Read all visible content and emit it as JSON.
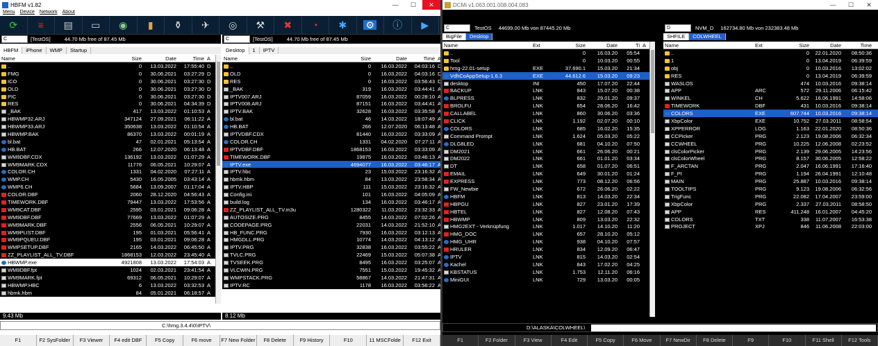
{
  "w1": {
    "title": "HBFM v1.82",
    "menu": [
      "Menu",
      "Device",
      "Network",
      "About"
    ],
    "toolbar_icons": [
      "refresh-icon",
      "stack-icon",
      "printer-icon",
      "hdd-icon",
      "disk-ok-icon",
      "battery-icon",
      "jar-icon",
      "plane-icon",
      "cd-icon",
      "tools-icon",
      "cancel-tools-icon",
      "gauge-icon",
      "photos-icon",
      "gear-icon",
      "info-icon",
      "exit-icon"
    ],
    "left": {
      "drive": "C",
      "label": "[TestOS]",
      "free": "44.70 Mb free of 87.45 Mb",
      "tabs": [
        "HBFM",
        "iPhone",
        "WMP",
        "Startup"
      ],
      "cols": [
        "Name",
        "Size",
        "Date",
        "Time",
        "A"
      ],
      "status": "9.43 Mb",
      "rows": [
        [
          "f",
          "..",
          "0",
          "13.03.2022",
          "17:55:40",
          "D"
        ],
        [
          "f",
          "FMG",
          "0",
          "30.06.2021",
          "03:27:29",
          "D"
        ],
        [
          "f",
          "ICO",
          "0",
          "30.06.2021",
          "03:27:30",
          "D"
        ],
        [
          "f",
          "OLD",
          "0",
          "30.06.2021",
          "03:27:30",
          "D"
        ],
        [
          "f",
          "PIC",
          "0",
          "30.06.2021",
          "03:27:30",
          "D"
        ],
        [
          "f",
          "RES",
          "0",
          "30.06.2021",
          "04:34:39",
          "D"
        ],
        [
          "d",
          "_BAK",
          "417",
          "13.03.2022",
          "01:10:53",
          "A"
        ],
        [
          "d",
          "HBWMP32.ARJ",
          "347124",
          "27.09.2021",
          "06:11:22",
          "A"
        ],
        [
          "d",
          "HBWMP33.ARJ",
          "350638",
          "13.03.2022",
          "01:10:54",
          "A"
        ],
        [
          "d",
          "HBWMP.BAK",
          "86370",
          "13.03.2022",
          "00:01:19",
          "A"
        ],
        [
          "b",
          "bl.bat",
          "47",
          "02.01.2021",
          "05:13:54",
          "A"
        ],
        [
          "b",
          "HB.BAT",
          "266",
          "12.07.2020",
          "06:13:48",
          "A"
        ],
        [
          "d",
          "WM9DBF.CDX",
          "136192",
          "13.03.2022",
          "01:07:29",
          "A"
        ],
        [
          "d",
          "WM9MARK.CDX",
          "11776",
          "06.05.2021",
          "10:29:07",
          "A"
        ],
        [
          "b",
          "COLOR.CH",
          "1331",
          "04.02.2020",
          "07:27:11",
          "A"
        ],
        [
          "b",
          "WMP.CH",
          "5430",
          "16.05.2005",
          "03:43:14",
          "A"
        ],
        [
          "b",
          "WMP6.CH",
          "5684",
          "13.09.2007",
          "01:17:04",
          "A"
        ],
        [
          "r",
          "COLOR.DBF",
          "2060",
          "28.12.2020",
          "04:56:43",
          "A"
        ],
        [
          "r",
          "TIMEWORK.DBF",
          "79447",
          "13.03.2022",
          "17:53:56",
          "A"
        ],
        [
          "r",
          "WM9CAT.DBF",
          "2595",
          "03.01.2021",
          "09:06:28",
          "A"
        ],
        [
          "r",
          "WM9DBF.DBF",
          "77669",
          "13.03.2022",
          "01:07:29",
          "A"
        ],
        [
          "r",
          "WM9MARK.DBF",
          "2556",
          "06.05.2021",
          "10:29:07",
          "A"
        ],
        [
          "r",
          "WM9PLIST.DBF",
          "195",
          "01.03.2021",
          "05:56:41",
          "A"
        ],
        [
          "r",
          "WM9PQUEU.DBF",
          "195",
          "03.01.2021",
          "09:06:28",
          "A"
        ],
        [
          "r",
          "WMPSETUP.DBF",
          "2165",
          "14.03.2022",
          "06:45:50",
          "A"
        ],
        [
          "r",
          "ZZ_PLAYLIST_ALL_TV.DBF",
          "1868153",
          "12.03.2022",
          "23:45:40",
          "A"
        ],
        [
          "s",
          "HBWMP.exe",
          "4921808",
          "13.03.2022",
          "17:54:03",
          "A"
        ],
        [
          "d",
          "WM9DBF.fpt",
          "1024",
          "02.03.2021",
          "23:41:54",
          "A"
        ],
        [
          "d",
          "WM9MARK.fpt",
          "69312",
          "06.05.2021",
          "10:29:07",
          "A"
        ],
        [
          "d",
          "HBWMP.HBC",
          "6",
          "13.03.2022",
          "03:32:53",
          "A"
        ],
        [
          "d",
          "hbmk.hbm",
          "84",
          "05.01.2021",
          "06:18:57",
          "A"
        ]
      ]
    },
    "right": {
      "drive": "C",
      "label": "[TestOS]",
      "free": "44.70 Mb free of 87.45 Mb",
      "tabs": [
        "Desktop",
        "1",
        "IPTV"
      ],
      "cols": [
        "Name",
        "Size",
        "Date",
        "Time",
        "A"
      ],
      "status": "8.12 Mb",
      "rows": [
        [
          "f",
          "..",
          "0",
          "16.03.2022",
          "04:03:16",
          "D"
        ],
        [
          "f",
          "OLD",
          "0",
          "16.03.2022",
          "04:03:16",
          "D"
        ],
        [
          "f",
          "RES",
          "0",
          "16.03.2022",
          "03:56:43",
          "D"
        ],
        [
          "d",
          "_BAK",
          "319",
          "16.03.2022",
          "03:44:41",
          "A"
        ],
        [
          "d",
          "IPTV007.ARJ",
          "87059",
          "16.03.2022",
          "00:28:10",
          "A"
        ],
        [
          "d",
          "IPTV008.ARJ",
          "87151",
          "16.03.2022",
          "03:44:41",
          "A"
        ],
        [
          "d",
          "IPTV.BAK",
          "32628",
          "16.03.2022",
          "03:35:58",
          "A"
        ],
        [
          "b",
          "bl.bat",
          "46",
          "14.03.2022",
          "18:07:49",
          "A"
        ],
        [
          "b",
          "HB.BAT",
          "266",
          "12.07.2020",
          "06:13:48",
          "A"
        ],
        [
          "d",
          "IPTVDBF.CDX",
          "81440",
          "16.03.2022",
          "03:33:09",
          "A"
        ],
        [
          "b",
          "COLOR.CH",
          "1331",
          "04.02.2020",
          "07:27:11",
          "A"
        ],
        [
          "r",
          "IPTVDBF.DBF",
          "1868153",
          "16.03.2022",
          "03:33:09",
          "A"
        ],
        [
          "r",
          "TIMEWORK.DBF",
          "19875",
          "16.03.2022",
          "03:46:13",
          "A"
        ],
        [
          "s",
          "IPTV.exe",
          "4694077",
          "16.03.2022",
          "03:46:17",
          "A"
        ],
        [
          "d",
          "IPTV.hbc",
          "23",
          "15.03.2022",
          "23:16:32",
          "A"
        ],
        [
          "d",
          "hbmk.hbm",
          "84",
          "13.03.2022",
          "23:58:34",
          "A"
        ],
        [
          "d",
          "IPTV.HBP",
          "111",
          "15.03.2022",
          "23:16:32",
          "A"
        ],
        [
          "d",
          "Config.ini",
          "101",
          "16.03.2022",
          "04:05:09",
          "A"
        ],
        [
          "d",
          "build.log",
          "134",
          "16.03.2022",
          "03:46:17",
          "A"
        ],
        [
          "w",
          "ZZ_PLAYLIST_ALL_TV.m3u",
          "1280322",
          "11.03.2022",
          "23:32:33",
          "A"
        ],
        [
          "d",
          "AUTOSIZE.PRG",
          "8455",
          "14.03.2022",
          "07:02:26",
          "A"
        ],
        [
          "d",
          "CODEPAGE.PRG",
          "22031",
          "14.03.2022",
          "21:52:10",
          "A"
        ],
        [
          "d",
          "HB_FUNC.PRG",
          "7930",
          "16.03.2022",
          "03:12:13",
          "A"
        ],
        [
          "d",
          "HMGDLL.PRG",
          "10774",
          "14.03.2022",
          "04:13:12",
          "A"
        ],
        [
          "d",
          "IPTV.PRG",
          "32838",
          "16.03.2022",
          "03:55:22",
          "A"
        ],
        [
          "d",
          "TVLC.PRG",
          "22469",
          "15.03.2022",
          "05:07:38",
          "A"
        ],
        [
          "d",
          "TVSEEK.PRG",
          "8495",
          "16.03.2022",
          "03:25:07",
          "A"
        ],
        [
          "d",
          "VLCWIN.PRG",
          "7551",
          "15.03.2022",
          "19:45:32",
          "A"
        ],
        [
          "d",
          "WMPSTACK.PRG",
          "58867",
          "14.03.2022",
          "21:47:31",
          "A"
        ],
        [
          "d",
          "IPTV.RC",
          "1178",
          "16.03.2022",
          "03:56:22",
          "A"
        ]
      ]
    },
    "cmdline": "C:\\hmg.3.4.4\\0\\IPTV\\",
    "fkeys": [
      "F1",
      "F2 SysFolder",
      "F3 Viewer",
      "F4 edit DBF",
      "F5 Copy",
      "F6 move",
      "F7 New Folder",
      "F8 Delete",
      "F9 History",
      "F10",
      "11 MSCFolde",
      "F12 Exit"
    ]
  },
  "w2": {
    "title": "DCMi v1.063.001.008.004.083",
    "left": {
      "drive": "C",
      "label": "TestOS",
      "free": "44699.00 Mb von 87445.20 Mb",
      "tabs": [
        "BigFile",
        "Desktop"
      ],
      "cols": [
        "Name",
        "Ext",
        "Size",
        "Date",
        "Ti",
        "A"
      ],
      "rows": [
        [
          "f",
          "..",
          "",
          "0",
          "16.03.20",
          "05:54"
        ],
        [
          "f",
          "Tool",
          "",
          "0",
          "10.03.20",
          "00:55"
        ],
        [
          "f",
          "hmg-22.01-setup",
          "EXE",
          "37.690.1",
          "15.03.20",
          "21:34"
        ],
        [
          "s",
          "VdhCoAppSetup-1.6.3",
          "EXE",
          "44.612.6",
          "15.03.20",
          "09:23"
        ],
        [
          "d",
          "desktop",
          "INI",
          "450",
          "17.07.20",
          "22:44"
        ],
        [
          "r",
          "BACKUP",
          "LNK",
          "843",
          "15.07.20",
          "00:38"
        ],
        [
          "b",
          "BLPRESS",
          "LNK",
          "832",
          "29.01.20",
          "09:37"
        ],
        [
          "r",
          "BROLFU",
          "LNK",
          "654",
          "28.06.20",
          "16:42"
        ],
        [
          "r",
          "CALLABEL",
          "LNK",
          "860",
          "30.06.20",
          "03:36"
        ],
        [
          "r",
          "CLICK",
          "LNK",
          "1.192",
          "02.07.20",
          "00:10"
        ],
        [
          "b",
          "COLORS",
          "LNK",
          "685",
          "16.02.20",
          "15:35"
        ],
        [
          "d",
          "Command Prompt",
          "LNK",
          "1.624",
          "05.03.20",
          "05:22"
        ],
        [
          "b",
          "DLG8LED",
          "LNK",
          "681",
          "04.10.20",
          "07:50"
        ],
        [
          "d",
          "DM2021",
          "LNK",
          "661",
          "26.06.20",
          "00:21"
        ],
        [
          "d",
          "DM2022",
          "LNK",
          "661",
          "01.01.20",
          "03:34"
        ],
        [
          "d",
          "DT",
          "LNK",
          "658",
          "01.07.20",
          "06:51"
        ],
        [
          "r",
          "EMAIL",
          "LNK",
          "649",
          "30.01.20",
          "01:24"
        ],
        [
          "r",
          "EXPRESS",
          "LNK",
          "773",
          "08.12.20",
          "06:56"
        ],
        [
          "d",
          "FW_Newbie",
          "LNK",
          "672",
          "26.06.20",
          "02:22"
        ],
        [
          "b",
          "HBFM",
          "LNK",
          "813",
          "14.03.20",
          "22:34"
        ],
        [
          "r",
          "HBPGU",
          "LNK",
          "827",
          "23.01.20",
          "17:39"
        ],
        [
          "r",
          "HBTEL",
          "LNK",
          "827",
          "12.08.20",
          "07:43"
        ],
        [
          "r",
          "HBWMP",
          "LNK",
          "809",
          "13.03.20",
          "22:32"
        ],
        [
          "d",
          "HMG2EXT - Verknüpfung",
          "LNK",
          "1.017",
          "14.10.20",
          "11:20"
        ],
        [
          "r",
          "HMG_DOC",
          "LNK",
          "657",
          "28.10.20",
          "05:12"
        ],
        [
          "b",
          "HMG_UHR",
          "LNK",
          "938",
          "04.10.20",
          "07:57"
        ],
        [
          "r",
          "HRULER",
          "LNK",
          "834",
          "12.09.20",
          "06:47"
        ],
        [
          "b",
          "IPTV",
          "LNK",
          "815",
          "14.03.20",
          "02:54"
        ],
        [
          "b",
          "Kachel",
          "LNK",
          "843",
          "17.02.20",
          "04:25"
        ],
        [
          "d",
          "KBSTATUS",
          "LNK",
          "1.753",
          "12.11.20",
          "06:16"
        ],
        [
          "b",
          "MiniGUI",
          "LNK",
          "729",
          "13.03.20",
          "00:05"
        ]
      ]
    },
    "right": {
      "drive": "D",
      "label": "NVM_D",
      "free": "162734.80 Mb von 232383.48 Mb",
      "tabs": [
        "SHFILE",
        "COLWHEEL"
      ],
      "cols": [
        "Name",
        "Ext",
        "Size",
        "Date",
        "Time"
      ],
      "rows": [
        [
          "f",
          "..",
          "",
          "0",
          "22.01.2020",
          "08:50:36"
        ],
        [
          "f",
          "1",
          "",
          "0",
          "13.04.2019",
          "06:39:59"
        ],
        [
          "f",
          "obj",
          "",
          "0",
          "10.03.2016",
          "13:02:02"
        ],
        [
          "f",
          "RES",
          "",
          "0",
          "13.04.2019",
          "06:39:59"
        ],
        [
          "d",
          "WASLOS",
          "",
          "474",
          "10.03.2016",
          "09:38:14"
        ],
        [
          "d",
          "APP",
          "ARC",
          "572",
          "29.11.2006",
          "06:15:42"
        ],
        [
          "d",
          "WINKEL",
          "CH",
          "5.622",
          "16.06.1991",
          "14:58:06"
        ],
        [
          "r",
          "TIMEWORK",
          "DBF",
          "431",
          "10.03.2016",
          "09:38:14"
        ],
        [
          "s",
          "COLORS",
          "EXE",
          "607.744",
          "10.03.2016",
          "09:38:14"
        ],
        [
          "d",
          "XbpColor",
          "EXE",
          "10.752",
          "27.03.2011",
          "08:58:54"
        ],
        [
          "d",
          "XPPERROR",
          "LOG",
          "1.163",
          "22.01.2020",
          "08:50:36"
        ],
        [
          "d",
          "CCPicker",
          "PRG",
          "2.123",
          "19.08.2006",
          "06:32:34"
        ],
        [
          "d",
          "CCWHEEL",
          "PRG",
          "10.225",
          "12.06.2008",
          "02:23:52"
        ],
        [
          "d",
          "clsColorPicker",
          "PRG",
          "2.139",
          "29.06.2005",
          "14:23:56"
        ],
        [
          "d",
          "clsColorWheel",
          "PRG",
          "8.157",
          "30.06.2005",
          "12:58:22"
        ],
        [
          "d",
          "F_ARCTAN",
          "PRG",
          "2.047",
          "16.06.1991",
          "17:16:40"
        ],
        [
          "d",
          "F_PI",
          "PRG",
          "1.194",
          "26.04.1991",
          "12:10:48"
        ],
        [
          "d",
          "MAIN",
          "PRG",
          "25.887",
          "10.03.2016",
          "09:38:14"
        ],
        [
          "d",
          "TOOLTIPS",
          "PRG",
          "9.123",
          "19.08.2006",
          "06:32:56"
        ],
        [
          "d",
          "TrigFunc",
          "PRG",
          "22.082",
          "17.04.2007",
          "23:59:00"
        ],
        [
          "d",
          "XbpColor",
          "PRG",
          "2.337",
          "27.03.2011",
          "08:58:50"
        ],
        [
          "d",
          "APP",
          "RES",
          "411.248",
          "16.01.2007",
          "04:45:20"
        ],
        [
          "d",
          "COLORS",
          "TXT",
          "338",
          "11.07.2007",
          "16:53:38"
        ],
        [
          "d",
          "PROJECT",
          "XPJ",
          "846",
          "11.06.2008",
          "22:03:00"
        ]
      ]
    },
    "cmdline": "D:\\ALASKA\\COLWHEEL\\",
    "fkeys": [
      "F1",
      "F2 Folder",
      "F3 View",
      "F4 Edit",
      "F5 Copy",
      "F6 Move",
      "F7 NewDir",
      "F8 Delete",
      "F9",
      "F10",
      "F11 Shell",
      "F12 Tools"
    ]
  }
}
